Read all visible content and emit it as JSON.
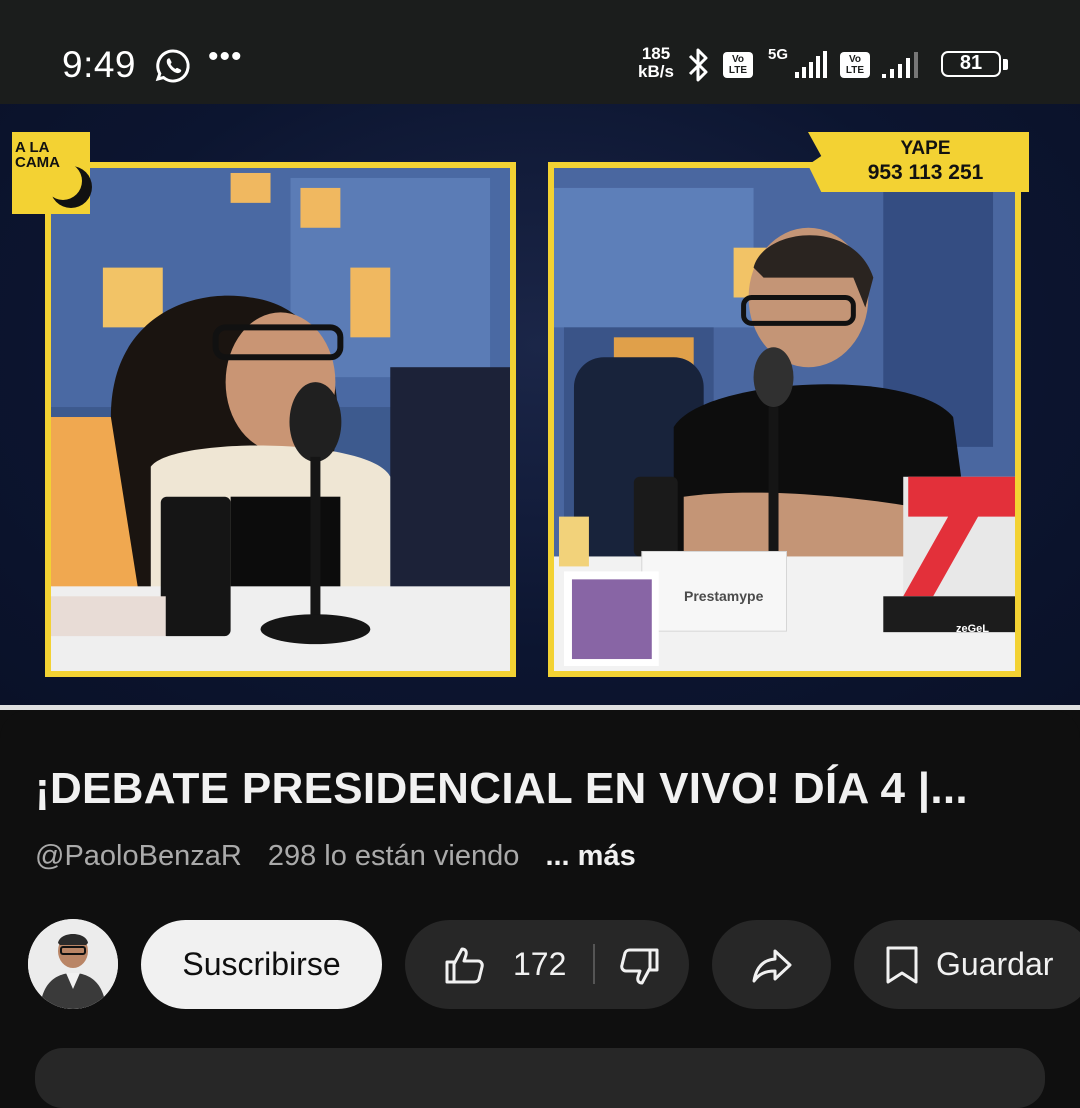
{
  "status_bar": {
    "time": "9:49",
    "net_speed_value": "185",
    "net_speed_unit": "kB/s",
    "volte_label_1": "Vo",
    "volte_label_2": "LTE",
    "network_type": "5G",
    "battery": "81",
    "icons": [
      "whatsapp-icon",
      "more-dots-icon",
      "bluetooth-icon",
      "volte-icon",
      "signal-icon",
      "battery-icon"
    ]
  },
  "video": {
    "show_logo_line1": "A LA",
    "show_logo_line2": "CAMA",
    "yape_label": "YAPE",
    "yape_number": "953 113 251",
    "sponsor_name": "Prestamype",
    "tv_brand": "zeGeL",
    "progress_fraction": 1.0
  },
  "video_info": {
    "title": "¡DEBATE PRESIDENCIAL EN VIVO! DÍA 4 |...",
    "channel": "@PaoloBenzaR",
    "viewers": "298 lo están viendo",
    "more": "... más"
  },
  "actions": {
    "subscribe_label": "Suscribirse",
    "like_count": "172",
    "save_label": "Guardar"
  },
  "colors": {
    "background": "#0f0f0f",
    "chip": "#272727",
    "subscribe_bg": "#f1f1f1",
    "frame_yellow": "#f3d233",
    "status_bar": "#1b1d1c"
  }
}
